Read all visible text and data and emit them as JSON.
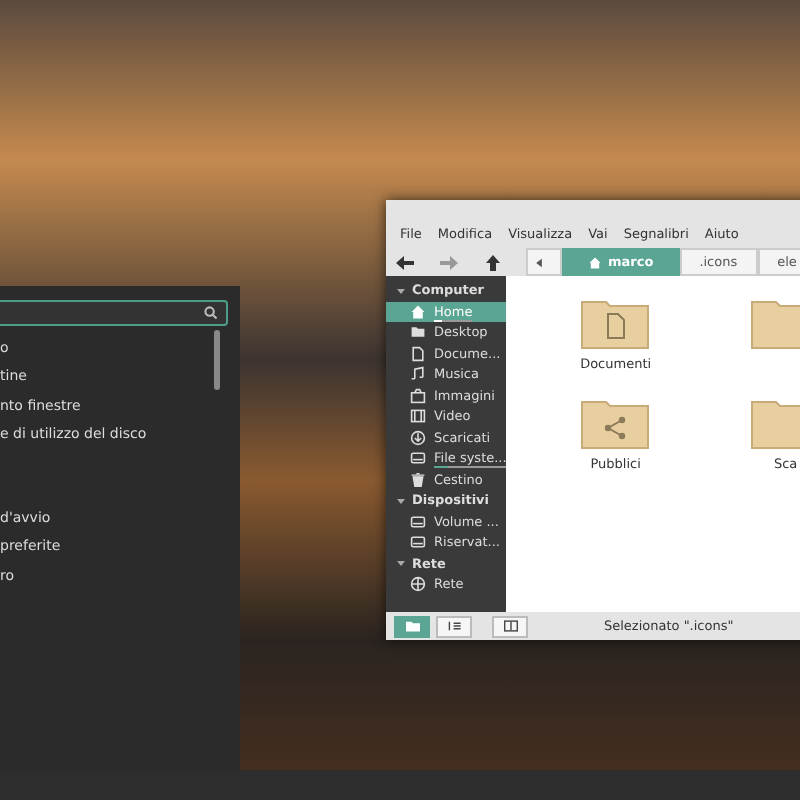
{
  "menu_panel": {
    "groups": [
      [
        "o",
        "tine",
        "nto finestre",
        "e di utilizzo del disco"
      ],
      [
        "d'avvio",
        "preferite",
        "ro"
      ]
    ]
  },
  "file_manager": {
    "menu": [
      "File",
      "Modifica",
      "Visualizza",
      "Vai",
      "Segnalibri",
      "Aiuto"
    ],
    "path": [
      {
        "label": "marco",
        "kind": "home",
        "selected": true
      },
      {
        "label": ".icons",
        "kind": "folder",
        "selected": false
      },
      {
        "label": "ele",
        "kind": "folder",
        "selected": false
      }
    ],
    "sidebar": [
      {
        "heading": "Computer",
        "expanded": true,
        "items": [
          {
            "label": "Home",
            "kind": "home",
            "selected": true,
            "level": 0.2
          },
          {
            "label": "Desktop",
            "kind": "folder",
            "selected": false
          },
          {
            "label": "Docume...",
            "kind": "document",
            "selected": false
          },
          {
            "label": "Musica",
            "kind": "music",
            "selected": false
          },
          {
            "label": "Immagini",
            "kind": "image",
            "selected": false
          },
          {
            "label": "Video",
            "kind": "video",
            "selected": false
          },
          {
            "label": "Scaricati",
            "kind": "download",
            "selected": false
          },
          {
            "label": "File syste...",
            "kind": "drive",
            "selected": false,
            "level": 0.2
          },
          {
            "label": "Cestino",
            "kind": "trash",
            "selected": false
          }
        ]
      },
      {
        "heading": "Dispositivi",
        "expanded": true,
        "items": [
          {
            "label": "Volume ...",
            "kind": "drive",
            "selected": false
          },
          {
            "label": "Riservat...",
            "kind": "drive",
            "selected": false
          }
        ]
      },
      {
        "heading": "Rete",
        "expanded": true,
        "items": [
          {
            "label": "Rete",
            "kind": "network",
            "selected": false
          }
        ]
      }
    ],
    "files": [
      {
        "label": "Documenti",
        "kind": "document"
      },
      {
        "kind": "plain"
      },
      {
        "label": "Pubblici",
        "kind": "share"
      },
      {
        "label": "Sca",
        "kind": "plain"
      }
    ],
    "view_buttons": [
      {
        "kind": "icons",
        "selected": true
      },
      {
        "kind": "list",
        "selected": false
      },
      {
        "kind": "compact",
        "selected": false
      }
    ],
    "status": "Selezionato \".icons\""
  }
}
